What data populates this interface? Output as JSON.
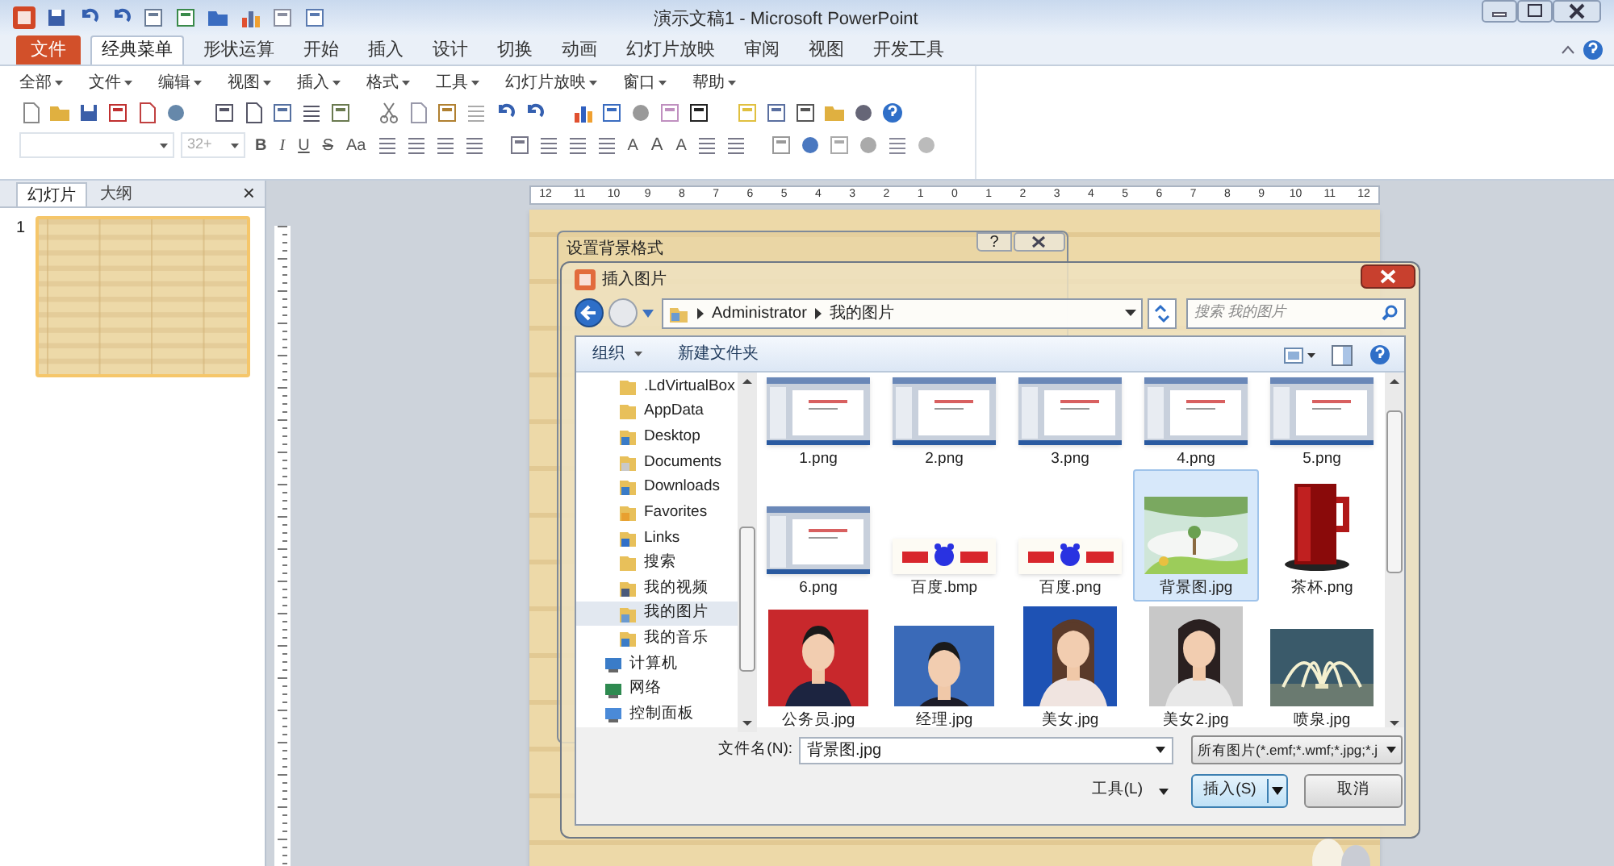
{
  "window": {
    "title": "演示文稿1 - Microsoft PowerPoint"
  },
  "ribbon_tabs": [
    {
      "label": "文件",
      "kind": "file",
      "selected": false
    },
    {
      "label": "经典菜单",
      "kind": "tab",
      "selected": true
    },
    {
      "label": "形状运算",
      "kind": "tab",
      "selected": false
    },
    {
      "label": "开始",
      "kind": "tab",
      "selected": false
    },
    {
      "label": "插入",
      "kind": "tab",
      "selected": false
    },
    {
      "label": "设计",
      "kind": "tab",
      "selected": false
    },
    {
      "label": "切换",
      "kind": "tab",
      "selected": false
    },
    {
      "label": "动画",
      "kind": "tab",
      "selected": false
    },
    {
      "label": "幻灯片放映",
      "kind": "tab",
      "selected": false
    },
    {
      "label": "审阅",
      "kind": "tab",
      "selected": false
    },
    {
      "label": "视图",
      "kind": "tab",
      "selected": false
    },
    {
      "label": "开发工具",
      "kind": "tab",
      "selected": false
    }
  ],
  "menu_bar": [
    "全部",
    "文件",
    "编辑",
    "视图",
    "插入",
    "格式",
    "工具",
    "幻灯片放映",
    "窗口",
    "帮助"
  ],
  "font_size_field": {
    "placeholder": "32+"
  },
  "format_buttons": [
    "B",
    "I",
    "U",
    "S",
    "Aa"
  ],
  "font_buttons": [
    "A",
    "A",
    "A"
  ],
  "side_panel": {
    "tabs": [
      {
        "label": "幻灯片",
        "selected": true
      },
      {
        "label": "大纲",
        "selected": false
      }
    ],
    "close": "×",
    "slides": [
      {
        "number": "1",
        "selected": true
      }
    ]
  },
  "ruler_labels": [
    "12",
    "11",
    "10",
    "9",
    "8",
    "7",
    "6",
    "5",
    "4",
    "3",
    "2",
    "1",
    "0",
    "1",
    "2",
    "3",
    "4",
    "5",
    "6",
    "7",
    "8",
    "9",
    "10",
    "11",
    "12"
  ],
  "background_dialog": {
    "title": "设置背景格式",
    "help": "?"
  },
  "insert_dialog": {
    "title": "插入图片",
    "breadcrumb": [
      "Administrator",
      "我的图片"
    ],
    "search": {
      "placeholder": "搜索 我的图片"
    },
    "commands": [
      "组织",
      "新建文件夹"
    ],
    "nav_tree": [
      {
        "children": [
          {
            "label": ".LdVirtualBox",
            "kind": "folder",
            "selected": false
          },
          {
            "label": "AppData",
            "kind": "folder",
            "selected": false
          },
          {
            "label": "Desktop",
            "kind": "folder",
            "selected": false
          },
          {
            "label": "Documents",
            "kind": "folder",
            "selected": false
          },
          {
            "label": "Downloads",
            "kind": "folder",
            "selected": false
          },
          {
            "label": "Favorites",
            "kind": "folder",
            "selected": false
          },
          {
            "label": "Links",
            "kind": "folder",
            "selected": false
          },
          {
            "label": "搜索",
            "kind": "folder",
            "selected": false
          },
          {
            "label": "我的视频",
            "kind": "folder",
            "selected": false
          },
          {
            "label": "我的图片",
            "kind": "folder",
            "selected": true
          },
          {
            "label": "我的音乐",
            "kind": "folder",
            "selected": false
          }
        ]
      },
      {
        "label": "计算机",
        "kind": "system",
        "selected": false
      },
      {
        "label": "网络",
        "kind": "system",
        "selected": false
      },
      {
        "label": "控制面板",
        "kind": "system",
        "selected": false
      }
    ],
    "files": [
      {
        "name": "1.png",
        "kind": "screenshot",
        "selected": false
      },
      {
        "name": "2.png",
        "kind": "screenshot",
        "selected": false
      },
      {
        "name": "3.png",
        "kind": "screenshot",
        "selected": false
      },
      {
        "name": "4.png",
        "kind": "screenshot",
        "selected": false
      },
      {
        "name": "5.png",
        "kind": "screenshot",
        "selected": false
      },
      {
        "name": "6.png",
        "kind": "screenshot",
        "selected": false
      },
      {
        "name": "百度.bmp",
        "kind": "logo",
        "selected": false
      },
      {
        "name": "百度.png",
        "kind": "logo",
        "selected": false
      },
      {
        "name": "背景图.jpg",
        "selected": true
      },
      {
        "name": "茶杯.png",
        "selected": false
      },
      {
        "name": "公务员.jpg",
        "selected": false
      },
      {
        "name": "经理.jpg",
        "selected": false
      },
      {
        "name": "美女.jpg",
        "selected": false
      },
      {
        "name": "美女2.jpg",
        "selected": false
      },
      {
        "name": "喷泉.jpg",
        "selected": false
      }
    ],
    "file_name": {
      "label": "文件名(N):",
      "value": "背景图.jpg"
    },
    "file_type": {
      "value": "所有图片(*.emf;*.wmf;*.jpg;*.j"
    },
    "tools": "工具(L)",
    "buttons": [
      {
        "label": "插入(S)",
        "kind": "split"
      },
      {
        "label": "取消",
        "kind": "plain"
      }
    ]
  }
}
